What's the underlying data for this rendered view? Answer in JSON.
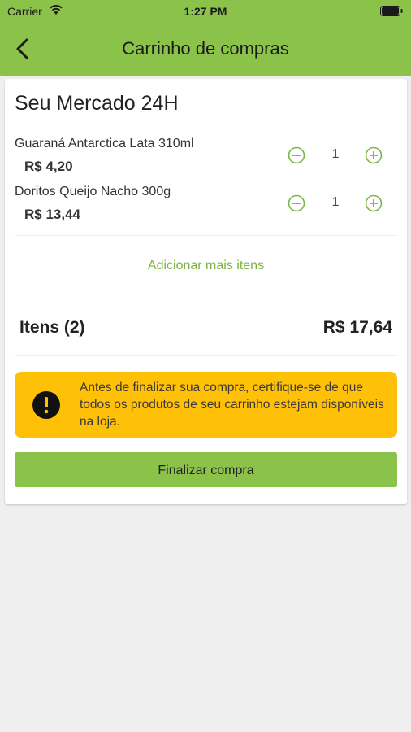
{
  "status_bar": {
    "carrier": "Carrier",
    "time": "1:27 PM"
  },
  "nav": {
    "title": "Carrinho de compras"
  },
  "store": {
    "name": "Seu Mercado 24H"
  },
  "items": [
    {
      "name": "Guaraná Antarctica Lata 310ml",
      "price": "R$ 4,20",
      "quantity": "1"
    },
    {
      "name": "Doritos Queijo Nacho 300g",
      "price": "R$ 13,44",
      "quantity": "1"
    }
  ],
  "add_more_label": "Adicionar mais itens",
  "summary": {
    "items_label": "Itens (2)",
    "total": "R$ 17,64"
  },
  "warning": {
    "text": "Antes de finalizar sua compra, certifique-se de que todos os produtos de seu carrinho estejam disponíveis na loja."
  },
  "finish_label": "Finalizar compra",
  "colors": {
    "primary": "#8bc34a",
    "accent": "#7cb342",
    "warning": "#ffc107",
    "background": "#efefef"
  }
}
